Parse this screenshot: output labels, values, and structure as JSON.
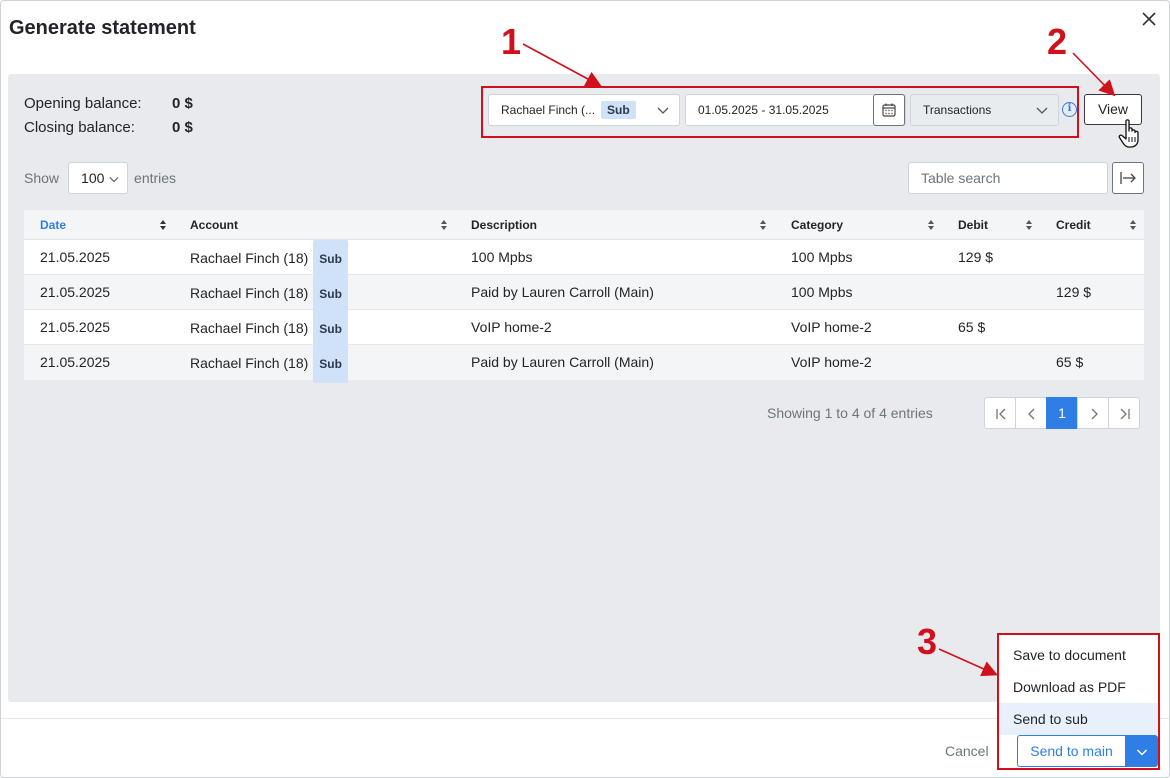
{
  "modal": {
    "title": "Generate statement"
  },
  "balance": {
    "opening_label": "Opening balance:",
    "opening_value": "0 $",
    "closing_label": "Closing balance:",
    "closing_value": "0 $"
  },
  "filters": {
    "account_label": "Rachael Finch (...",
    "account_badge": "Sub",
    "date_range": "01.05.2025 - 31.05.2025",
    "type": "Transactions",
    "view_label": "View"
  },
  "table_controls": {
    "show_label": "Show",
    "entries_value": "100",
    "entries_label": "entries",
    "search_placeholder": "Table search"
  },
  "table": {
    "columns": [
      "Date",
      "Account",
      "Description",
      "Category",
      "Debit",
      "Credit"
    ],
    "rows": [
      {
        "date": "21.05.2025",
        "account": "Rachael Finch (18)",
        "badge": "Sub",
        "description": "100 Mpbs",
        "category": "100 Mpbs",
        "debit": "129 $",
        "credit": ""
      },
      {
        "date": "21.05.2025",
        "account": "Rachael Finch (18)",
        "badge": "Sub",
        "description": "Paid by Lauren Carroll (Main)",
        "category": "100 Mpbs",
        "debit": "",
        "credit": "129 $"
      },
      {
        "date": "21.05.2025",
        "account": "Rachael Finch (18)",
        "badge": "Sub",
        "description": "VoIP home-2",
        "category": "VoIP home-2",
        "debit": "65 $",
        "credit": ""
      },
      {
        "date": "21.05.2025",
        "account": "Rachael Finch (18)",
        "badge": "Sub",
        "description": "Paid by Lauren Carroll (Main)",
        "category": "VoIP home-2",
        "debit": "",
        "credit": "65 $"
      }
    ]
  },
  "pagination": {
    "info": "Showing 1 to 4 of 4 entries",
    "current_page": "1"
  },
  "footer": {
    "cancel_label": "Cancel",
    "send_main_label": "Send to main",
    "dropdown_items": [
      "Save to document",
      "Download as PDF",
      "Send to sub"
    ]
  },
  "annotations": {
    "step1": "1",
    "step2": "2",
    "step3": "3"
  },
  "colors": {
    "accent": "#2f7ee6",
    "annotation_red": "#d0101b",
    "panel_bg": "#e8eaed",
    "badge_bg": "#cfe2f8"
  },
  "icons": [
    "close-icon",
    "chevron-down-icon",
    "calendar-icon",
    "info-icon",
    "pointer-hand-icon",
    "export-arrow-icon",
    "sort-icon",
    "first-page-icon",
    "prev-page-icon",
    "next-page-icon",
    "last-page-icon"
  ]
}
